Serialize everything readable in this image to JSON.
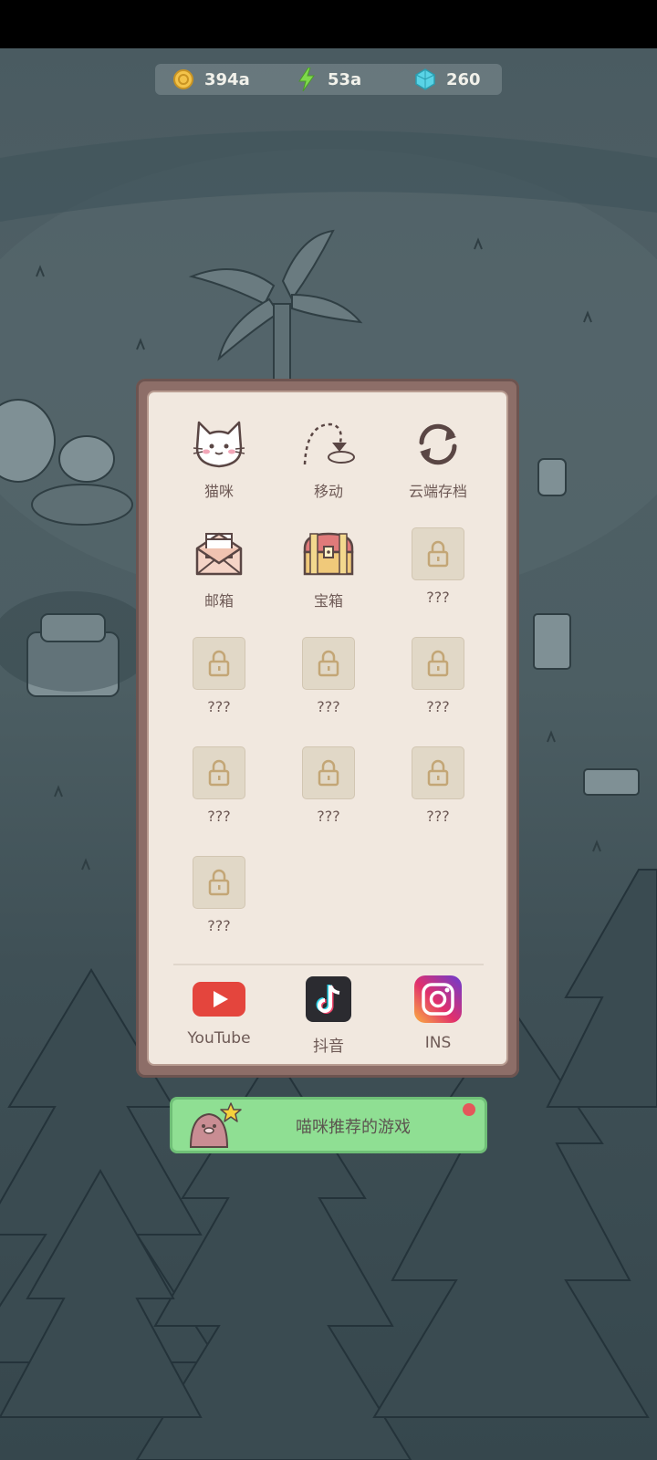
{
  "currency": {
    "coins": "394a",
    "energy": "53a",
    "gems": "260"
  },
  "menu": {
    "items": [
      {
        "label": "猫咪",
        "icon": "cat-icon",
        "locked": false
      },
      {
        "label": "移动",
        "icon": "move-icon",
        "locked": false
      },
      {
        "label": "云端存档",
        "icon": "cloud-sync-icon",
        "locked": false
      },
      {
        "label": "邮箱",
        "icon": "mail-icon",
        "locked": false
      },
      {
        "label": "宝箱",
        "icon": "treasure-chest-icon",
        "locked": false
      },
      {
        "label": "???",
        "icon": "lock-icon",
        "locked": true
      },
      {
        "label": "???",
        "icon": "lock-icon",
        "locked": true
      },
      {
        "label": "???",
        "icon": "lock-icon",
        "locked": true
      },
      {
        "label": "???",
        "icon": "lock-icon",
        "locked": true
      },
      {
        "label": "???",
        "icon": "lock-icon",
        "locked": true
      },
      {
        "label": "???",
        "icon": "lock-icon",
        "locked": true
      },
      {
        "label": "???",
        "icon": "lock-icon",
        "locked": true
      },
      {
        "label": "???",
        "icon": "lock-icon",
        "locked": true
      }
    ]
  },
  "social": {
    "youtube": "YouTube",
    "douyin": "抖音",
    "instagram": "INS"
  },
  "recommend_button": {
    "label": "喵咪推荐的游戏"
  },
  "colors": {
    "panel_border": "#8d6e68",
    "panel_bg": "#f1e8df",
    "text": "#6e5a56",
    "button_green": "#8fdf93",
    "youtube_red": "#e4453d"
  }
}
